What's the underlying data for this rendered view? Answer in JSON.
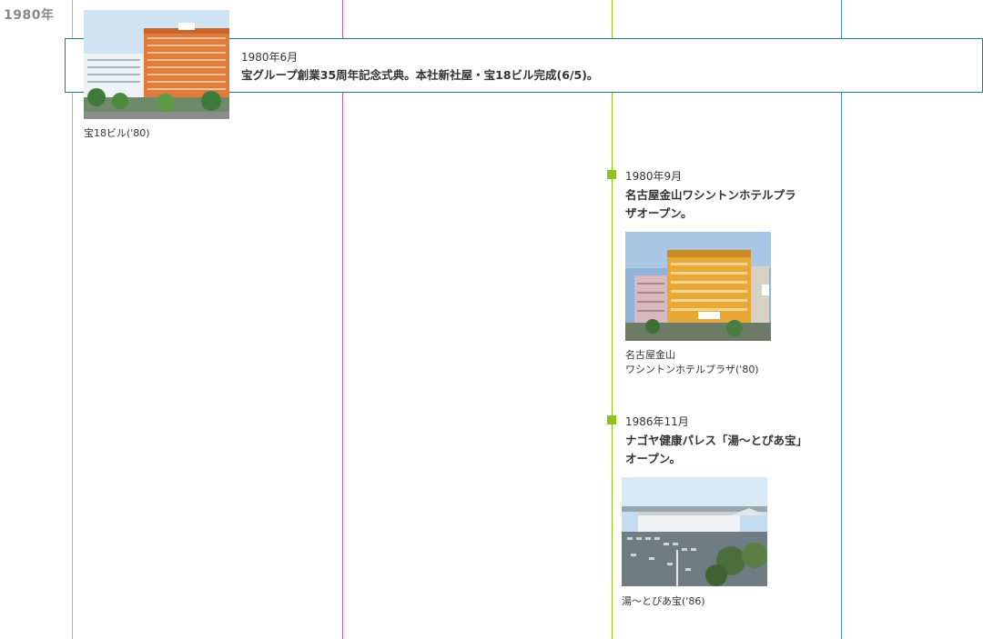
{
  "year_label": "1980年",
  "events": [
    {
      "date": "1980年6月",
      "title": "宝グループ創業35周年記念式典。本社新社屋・宝18ビル完成(6/5)。",
      "caption": "宝18ビル('80)"
    },
    {
      "date": "1980年9月",
      "title_line1": "名古屋金山ワシントンホテルプラ",
      "title_line2": "ザオープン。",
      "caption_line1": "名古屋金山",
      "caption_line2": "ワシントンホテルプラザ('80)"
    },
    {
      "date": "1986年11月",
      "title_line1": "ナゴヤ健康パレス「湯〜とぴあ宝」",
      "title_line2": "オープン。",
      "caption": "湯〜とぴあ宝('86)"
    }
  ],
  "colors": {
    "line1": "#e6b422",
    "line2": "#d65b9a",
    "line3": "#8dc21f",
    "line4": "#39a0d8",
    "highlight_border": "#1f7a8c",
    "marker": "#8dc21f"
  }
}
